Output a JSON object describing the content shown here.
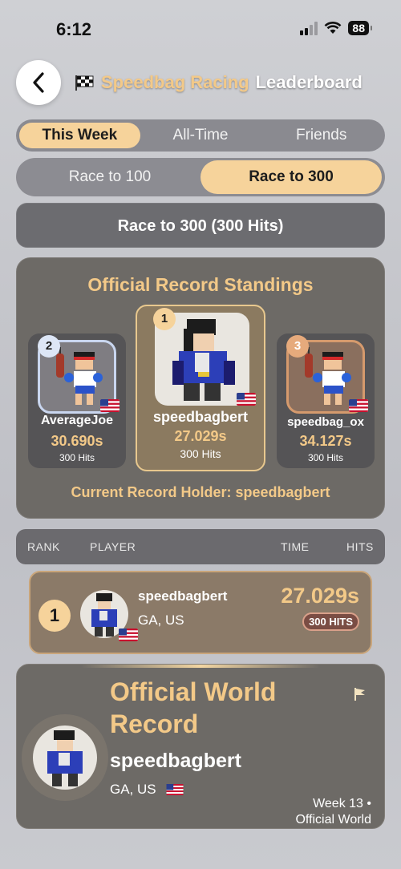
{
  "status": {
    "time": "6:12",
    "battery": "88"
  },
  "header": {
    "title_accent": "Speedbag Racing",
    "title_plain": "Leaderboard"
  },
  "period_tabs": [
    "This Week",
    "All-Time",
    "Friends"
  ],
  "race_tabs": [
    "Race to 100",
    "Race to 300"
  ],
  "race_title": "Race to 300 (300 Hits)",
  "standings": {
    "title": "Official Record Standings",
    "podium": [
      {
        "rank": "2",
        "name": "AverageJoe",
        "time": "30.690s",
        "hits": "300 Hits"
      },
      {
        "rank": "1",
        "name": "speedbagbert",
        "time": "27.029s",
        "hits": "300 Hits"
      },
      {
        "rank": "3",
        "name": "speedbag_ox",
        "time": "34.127s",
        "hits": "300 Hits"
      }
    ],
    "holder": "Current Record Holder: speedbagbert"
  },
  "columns": {
    "rank": "RANK",
    "player": "PLAYER",
    "time": "TIME",
    "hits": "HITS"
  },
  "rows": [
    {
      "rank": "1",
      "name": "speedbagbert",
      "location": "GA, US",
      "time": "27.029s",
      "hits": "300 HITS"
    }
  ],
  "world_record": {
    "title": "Official World Record",
    "name": "speedbagbert",
    "location": "GA, US",
    "meta_line1": "Week 13 •",
    "meta_line2": "Official World"
  },
  "colors": {
    "accent": "#f3c988",
    "active_tab": "#f6d39b",
    "card": "#6d6a66"
  }
}
